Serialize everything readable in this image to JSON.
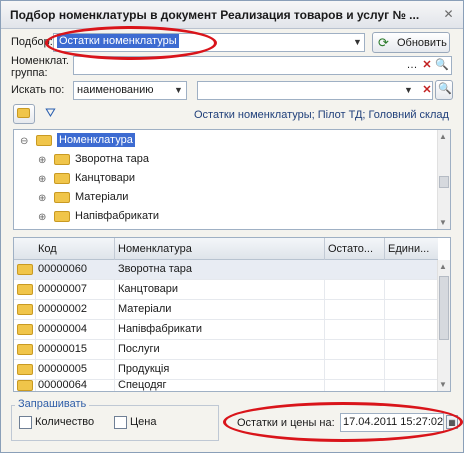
{
  "window": {
    "title": "Подбор номенклатуры в документ Реализация товаров и услуг № ...",
    "close_glyph": "✕"
  },
  "form": {
    "podbor_label": "Подбор:",
    "podbor_value": "Остатки номенклатуры",
    "refresh_label": "Обновить",
    "nomgroup_label_line1": "Номенклат.",
    "nomgroup_label_line2": "группа:",
    "nomgroup_value": "",
    "search_label": "Искать по:",
    "search_by_value": "наименованию",
    "search_text": "",
    "info_text": "Остатки номенклатуры; Пілот ТД; Головний склад"
  },
  "tree": {
    "root": "Номенклатура",
    "items": [
      "Зворотна тара",
      "Канцтовари",
      "Матеріали",
      "Напівфабрикати"
    ]
  },
  "grid": {
    "columns": [
      "Код",
      "Номенклатура",
      "Остато...",
      "Едини..."
    ],
    "rows": [
      {
        "code": "00000060",
        "name": "Зворотна тара"
      },
      {
        "code": "00000007",
        "name": "Канцтовари"
      },
      {
        "code": "00000002",
        "name": "Матеріали"
      },
      {
        "code": "00000004",
        "name": "Напівфабрикати"
      },
      {
        "code": "00000015",
        "name": "Послуги"
      },
      {
        "code": "00000005",
        "name": "Продукція"
      },
      {
        "code": "00000064",
        "name": "Спецодяг"
      }
    ]
  },
  "ask": {
    "title": "Запрашивать",
    "quantity_label": "Количество",
    "price_label": "Цена",
    "quantity_checked": false,
    "price_checked": false
  },
  "footer": {
    "prices_label": "Остатки и цены на:",
    "prices_date": "17.04.2011 15:27:02"
  },
  "colors": {
    "selection": "#3d6bd1",
    "annotation_red": "#d9141a",
    "info_text": "#1f3f7a"
  }
}
